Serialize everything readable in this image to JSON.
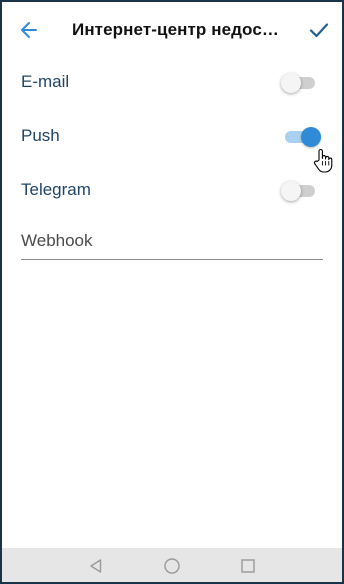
{
  "header": {
    "title": "Интернет-центр недос…",
    "back_icon": "arrow-left-icon",
    "done_icon": "check-icon"
  },
  "channels": [
    {
      "label": "E-mail",
      "enabled": false
    },
    {
      "label": "Push",
      "enabled": true
    },
    {
      "label": "Telegram",
      "enabled": false
    }
  ],
  "webhook": {
    "placeholder": "Webhook",
    "value": ""
  },
  "nav": {
    "back_icon": "triangle-back-icon",
    "home_icon": "circle-home-icon",
    "recent_icon": "square-recent-icon"
  },
  "colors": {
    "accent": "#2f8bd8",
    "label_text": "#1f4566",
    "frame_border": "#1b3347",
    "nav_bar": "#e6e6e6"
  }
}
